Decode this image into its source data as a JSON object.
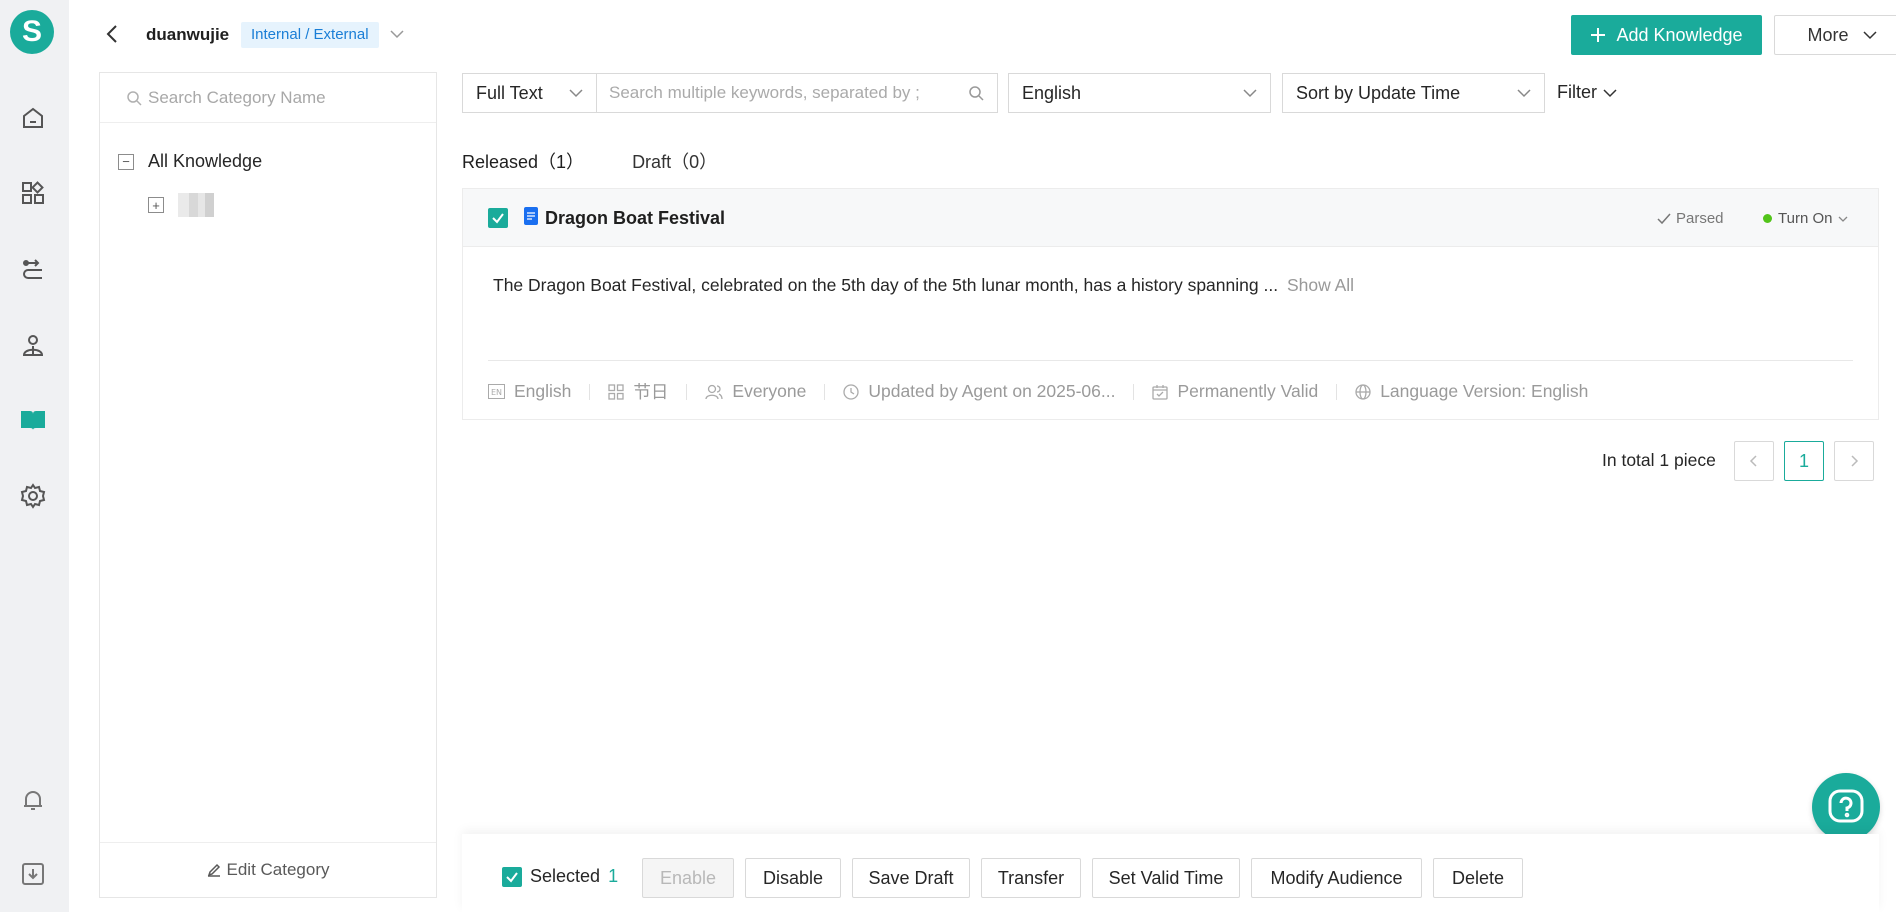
{
  "app": {
    "logo_letter": "S",
    "accent": "#1aab9b"
  },
  "leftnav": {
    "icons": [
      "home-icon",
      "apps-icon",
      "route-icon",
      "agent-icon",
      "knowledge-book-icon",
      "settings-gear-icon",
      "bell-icon",
      "download-icon"
    ],
    "active": "knowledge-book-icon"
  },
  "header": {
    "title": "duanwujie",
    "badge": "Internal / External",
    "add_button": "Add Knowledge",
    "more_button": "More"
  },
  "category": {
    "search_placeholder": "Search Category Name",
    "root_label": "All Knowledge",
    "edit_label": "Edit Category"
  },
  "filters": {
    "scope": "Full Text",
    "keyword_placeholder": "Search multiple keywords, separated by ;",
    "language": "English",
    "sort": "Sort by Update Time",
    "filter_label": "Filter"
  },
  "tabs": [
    {
      "label": "Released（1）"
    },
    {
      "label": "Draft（0）"
    }
  ],
  "knowledge_item": {
    "title": "Dragon Boat Festival",
    "parse_status": "Parsed",
    "enable_status": "Turn On",
    "body": "The Dragon Boat Festival, celebrated on the 5th day of the 5th lunar month, has a history spanning ...",
    "show_all": "Show All",
    "meta": {
      "language": "English",
      "category": "节日",
      "audience": "Everyone",
      "updated": "Updated by Agent on 2025-06...",
      "validity": "Permanently Valid",
      "language_version": "Language Version: English"
    }
  },
  "pagination": {
    "total_text": "In total 1 piece",
    "current_page": "1"
  },
  "bulk_bar": {
    "selected_label": "Selected",
    "selected_count": "1",
    "actions": [
      "Enable",
      "Disable",
      "Save Draft",
      "Transfer",
      "Set Valid Time",
      "Modify Audience",
      "Delete"
    ]
  }
}
